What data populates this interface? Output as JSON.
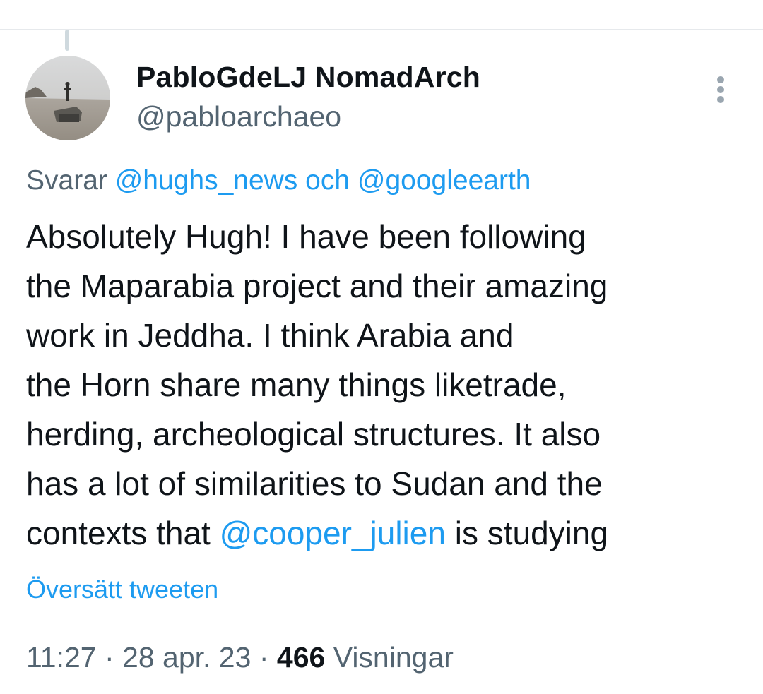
{
  "tweet": {
    "author": {
      "display_name": "PabloGdeLJ NomadArch",
      "handle": "@pabloarchaeo",
      "avatar_alt": "avatar"
    },
    "replying": {
      "prefix": "Svarar",
      "mention1": "@hughs_news",
      "conjunction": "och",
      "mention2": "@googleearth"
    },
    "body": {
      "line1": "Absolutely Hugh! I have been following",
      "line2": "the Maparabia project and their amazing",
      "line3": "work in Jeddha. I think Arabia and",
      "line4": "the Horn share many things liketrade,",
      "line5": "herding, archeological structures. It also",
      "line6": "has a lot of similarities to Sudan and the",
      "line7_before": "contexts that",
      "line7_mention": "@cooper_julien",
      "line7_after": "is studying"
    },
    "translate_label": "Översätt tweeten",
    "meta": {
      "time": "11:27",
      "separator": "·",
      "date": "28 apr. 23",
      "views_count": "466",
      "views_label": "Visningar"
    }
  },
  "colors": {
    "link": "#1d9bf0",
    "secondary_text": "#536471",
    "primary_text": "#0f1419"
  },
  "icons": {
    "more": "vertical-ellipsis-icon"
  }
}
